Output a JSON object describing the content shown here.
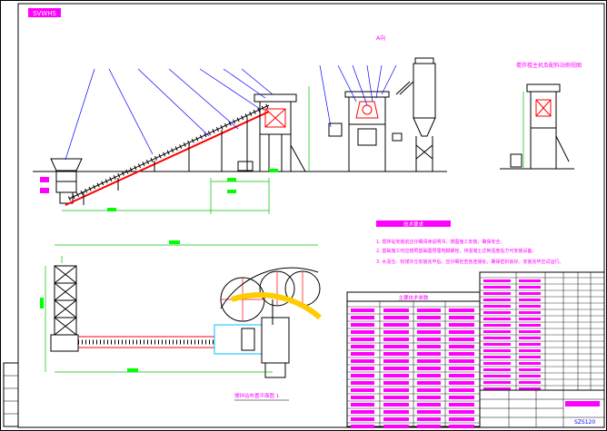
{
  "drawing": {
    "corner_tag": "SVWHS",
    "elevation_label": "A向",
    "side_view_title": "搅拌楼主机及配料站侧视图",
    "plan_note": "搅拌站布置平面图 1",
    "drawing_number": "SZS120",
    "colors": {
      "outline": "#000000",
      "callout": "#0000ff",
      "conveyor": "#ff0000",
      "dimension": "#00c000",
      "dim_label": "#00ff00",
      "note_text": "#ff00ff"
    }
  },
  "technical_notes": {
    "heading": "技术要求",
    "lines": [
      "1. 搅拌站安装前应仔细阅读说明书，按图施工安装，确保安全。",
      "2. 基础施工时应按照基础图预埋地脚螺栓，待混凝土达到强度后方可安装设备。",
      "3. 水泥仓、粉煤灰仓安装完毕后，应仔细检查各连接处，确保密封良好。安装完毕应试运行。"
    ]
  },
  "parameter_table": {
    "title": "主要技术参数"
  }
}
